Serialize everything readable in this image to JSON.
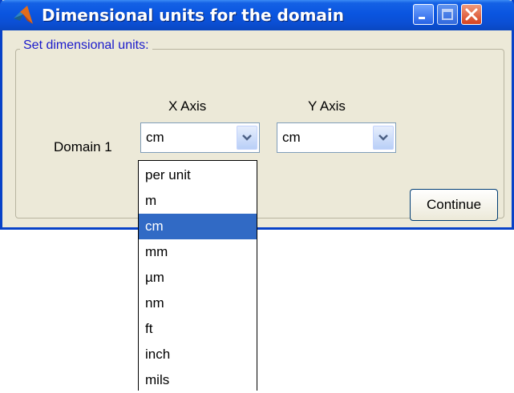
{
  "window": {
    "title": "Dimensional units for the domain",
    "title_bar_buttons": [
      "minimize-icon",
      "maximize-icon",
      "close-icon"
    ],
    "app_icon": "matlab-icon"
  },
  "group": {
    "legend": "Set dimensional units:"
  },
  "axes": {
    "x_label": "X Axis",
    "y_label": "Y Axis"
  },
  "row": {
    "label": "Domain 1",
    "x_value": "cm",
    "y_value": "cm"
  },
  "continue_label": "Continue",
  "dropdown": {
    "items": [
      "per unit",
      "m",
      "cm",
      "mm",
      "µm",
      "nm",
      "ft",
      "inch",
      "mils"
    ],
    "selected": "cm"
  },
  "colors": {
    "title_bar": "#0a55e0",
    "selection": "#316ac5",
    "legend_text": "#1a1acc",
    "dialog_bg": "#ece9d8"
  }
}
